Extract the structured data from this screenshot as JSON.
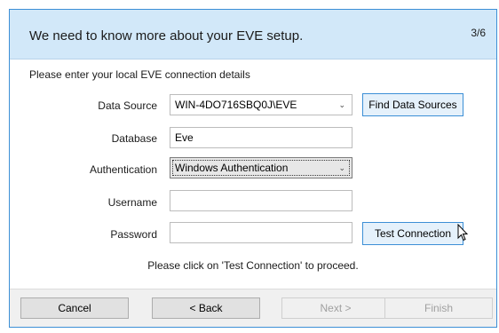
{
  "header": {
    "title": "We need to know more about your EVE setup.",
    "step": "3/6"
  },
  "intro": "Please enter your local EVE connection details",
  "form": {
    "data_source": {
      "label": "Data Source",
      "value": "WIN-4DO716SBQ0J\\EVE"
    },
    "find_data_sources": "Find Data Sources",
    "database": {
      "label": "Database",
      "value": "Eve"
    },
    "authentication": {
      "label": "Authentication",
      "value": "Windows Authentication"
    },
    "username": {
      "label": "Username",
      "value": ""
    },
    "password": {
      "label": "Password",
      "value": ""
    },
    "test_connection": "Test Connection"
  },
  "hint": "Please click on 'Test Connection' to proceed.",
  "footer": {
    "cancel": "Cancel",
    "back": "< Back",
    "next": "Next >",
    "finish": "Finish"
  },
  "colors": {
    "header_bg": "#d2e8f9",
    "accent": "#3c8fd6",
    "footer_bg": "#f0f0f0"
  }
}
